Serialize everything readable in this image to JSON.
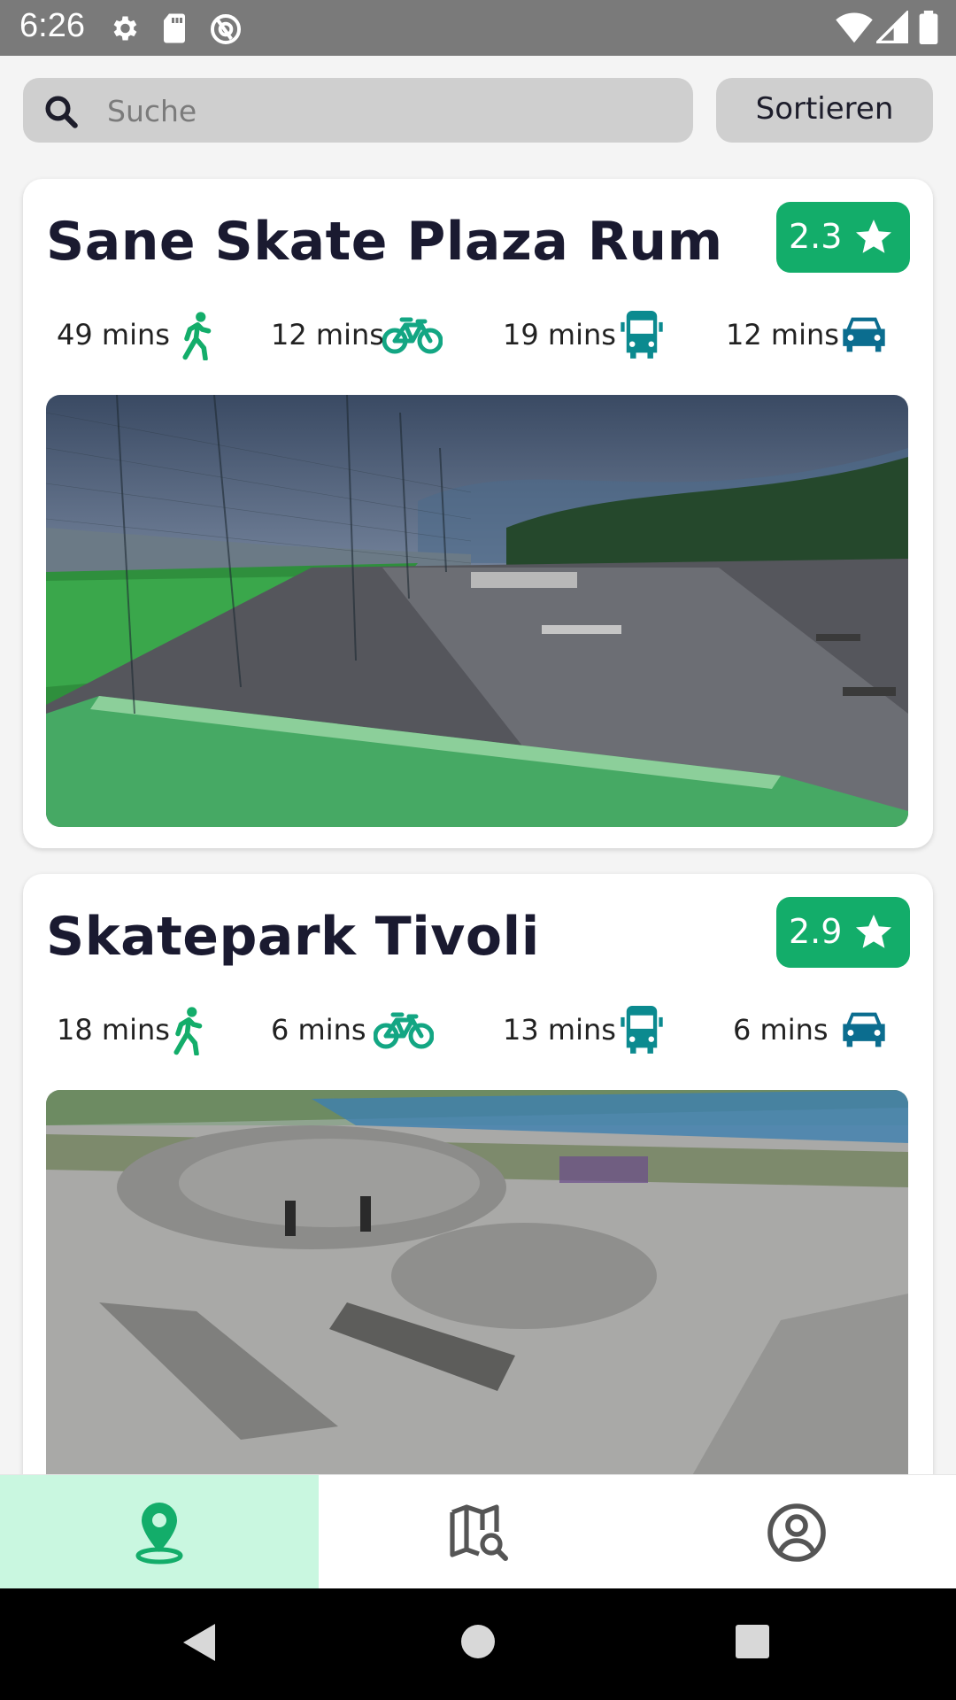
{
  "status_bar": {
    "time": "6:26"
  },
  "search": {
    "placeholder": "Suche"
  },
  "sort": {
    "label": "Sortieren"
  },
  "cards": [
    {
      "name": "Sane Skate Plaza Rum",
      "rating": "2.3",
      "travel": {
        "walk": "49 mins",
        "bike": "12 mins",
        "bus": "19 mins",
        "car": "12 mins"
      }
    },
    {
      "name": "Skatepark Tivoli",
      "rating": "2.9",
      "travel": {
        "walk": "18 mins",
        "bike": "6 mins",
        "bus": "13 mins",
        "car": "6 mins"
      }
    }
  ],
  "colors": {
    "accent": "#13ad6a",
    "travel_walk": "#13ad6a",
    "travel_bike": "#13a683",
    "travel_bus": "#0b8a8f",
    "travel_car": "#0b6d8f",
    "nav_active_bg": "#c9f7e0"
  },
  "nav": {
    "active": "map-list"
  }
}
